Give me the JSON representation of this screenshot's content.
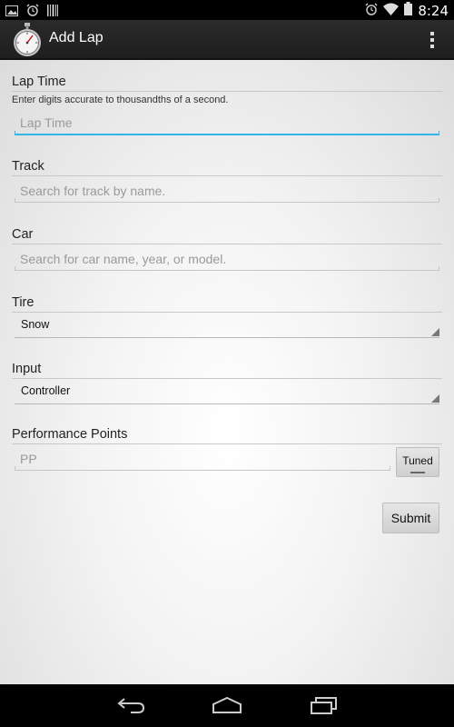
{
  "status_bar": {
    "time": "8:24",
    "left_icons": [
      "gallery-icon",
      "alarm-icon",
      "barcode-icon"
    ],
    "right_icons": [
      "alarm-icon",
      "wifi-icon",
      "battery-icon"
    ]
  },
  "action_bar": {
    "title": "Add Lap",
    "app_icon": "stopwatch-icon",
    "overflow_icon": "overflow-menu-icon"
  },
  "form": {
    "lap_time": {
      "label": "Lap Time",
      "hint": "Enter digits accurate to thousandths of a second.",
      "placeholder": "Lap Time"
    },
    "track": {
      "label": "Track",
      "placeholder": "Search for track by name."
    },
    "car": {
      "label": "Car",
      "placeholder": "Search for car name, year, or model."
    },
    "tire": {
      "label": "Tire",
      "selected": "Snow"
    },
    "input": {
      "label": "Input",
      "selected": "Controller"
    },
    "performance_points": {
      "label": "Performance Points",
      "placeholder": "PP",
      "tuned_label": "Tuned"
    },
    "submit_label": "Submit"
  },
  "nav_bar": {
    "icons": [
      "back-icon",
      "home-icon",
      "recent-apps-icon"
    ]
  },
  "colors": {
    "focus_accent": "#33b5e5",
    "action_bar": "#222222"
  }
}
